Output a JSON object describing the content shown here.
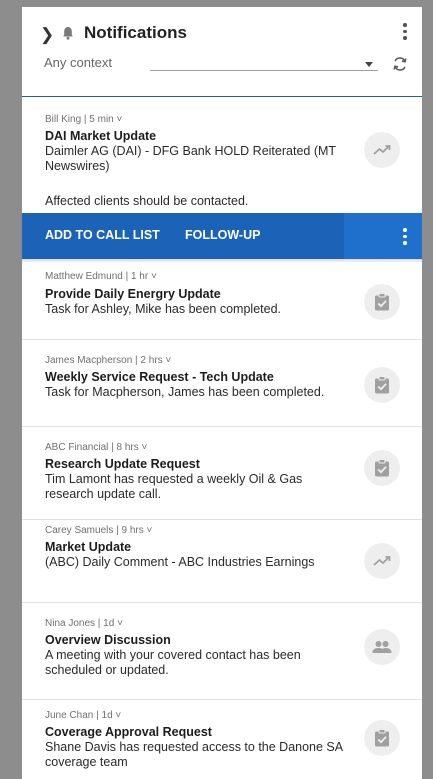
{
  "header": {
    "title": "Notifications",
    "context_value": "Any context"
  },
  "icons": {
    "chevron": "chevron-right-icon",
    "bell": "bell-icon",
    "more": "more-vert-icon",
    "refresh": "refresh-icon",
    "trend": "trending-up-icon",
    "task": "assignment-check-icon",
    "people": "people-icon"
  },
  "colors": {
    "accent": "#1c63b7",
    "circle_bg": "#eeeeee",
    "icon_gray": "#9a9a9a"
  },
  "expanded": {
    "meta": "Bill King  |  5 min  ˅",
    "title": "DAI Market Update",
    "body": "Daimler AG (DAI) - DFG Bank HOLD Reiterated (MT Newswires)",
    "note": "Affected clients should be contacted.",
    "actions": {
      "add_to_call_list": "ADD TO CALL LIST",
      "follow_up": "FOLLOW-UP"
    }
  },
  "items": [
    {
      "meta": "Matthew Edmund  |  1 hr  ˅",
      "title": "Provide Daily Energry Update",
      "body": "Task for Ashley, Mike has been completed.",
      "icon": "task"
    },
    {
      "meta": "James Macpherson  |  2 hrs  ˅",
      "title": "Weekly Service Request - Tech Update",
      "body": "Task for Macpherson, James has been completed.",
      "icon": "task"
    },
    {
      "meta": "ABC Financial | 8 hrs  ˅",
      "title": "Research Update Request",
      "body": "Tim Lamont has requested a weekly Oil & Gas research update call.",
      "icon": "task"
    },
    {
      "meta": "Carey Samuels  |  9 hrs  ˅",
      "title": "Market Update",
      "body": "(ABC) Daily Comment - ABC Industries Earnings",
      "icon": "trend"
    },
    {
      "meta": "Nina Jones  |  1d  ˅",
      "title": "Overview Discussion",
      "body": "A meeting with your covered contact has been scheduled or updated.",
      "icon": "people"
    },
    {
      "meta": "June Chan  |  1d  ˅",
      "title": "Coverage Approval Request",
      "body": "Shane Davis has requested access to the Danone SA coverage team",
      "icon": "task"
    }
  ]
}
